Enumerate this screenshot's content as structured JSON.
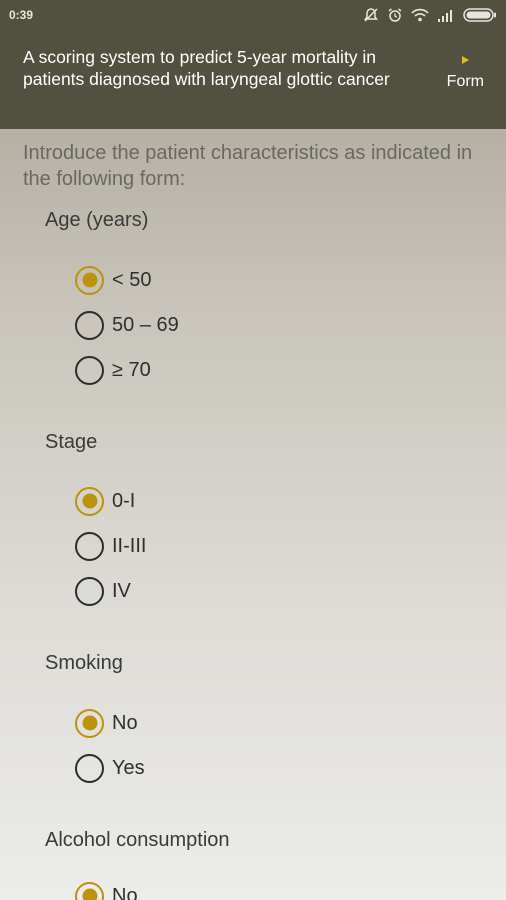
{
  "status_bar": {
    "time": "0:39",
    "icons": [
      "notifications-off-icon",
      "alarm-icon",
      "wifi-icon",
      "signal-icon",
      "battery-icon"
    ]
  },
  "app_bar": {
    "title": "A scoring system to predict 5-year mortality in patients diagnosed with laryngeal glottic cancer",
    "action_label": "Form",
    "action_icon": "play-arrow-icon"
  },
  "intro_text": "Introduce the patient characteristics as indicated in the following form:",
  "sections": {
    "age": {
      "label": "Age (years)",
      "options": [
        "< 50",
        "50 – 69",
        "≥ 70"
      ],
      "selected": "< 50"
    },
    "stage": {
      "label": "Stage",
      "options": [
        "0-I",
        "II-III",
        "IV"
      ],
      "selected": "0-I"
    },
    "smoking": {
      "label": "Smoking",
      "options": [
        "No",
        "Yes"
      ],
      "selected": "No"
    },
    "alcohol": {
      "label": "Alcohol consumption",
      "options": [
        "No"
      ],
      "selected": "No"
    }
  },
  "colors": {
    "header": "#52503f",
    "accent": "#bd920c",
    "action_arrow": "#d9c21a"
  }
}
